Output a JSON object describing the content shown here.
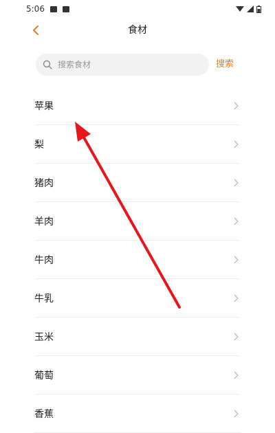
{
  "status_bar": {
    "time": "5:06"
  },
  "header": {
    "title": "食材"
  },
  "search": {
    "placeholder": "搜索食材",
    "button_label": "搜索"
  },
  "foods": [
    {
      "label": "苹果"
    },
    {
      "label": "梨"
    },
    {
      "label": "猪肉"
    },
    {
      "label": "羊肉"
    },
    {
      "label": "牛肉"
    },
    {
      "label": "牛乳"
    },
    {
      "label": "玉米"
    },
    {
      "label": "葡萄"
    },
    {
      "label": "香蕉"
    }
  ],
  "colors": {
    "accent": "#f07a22",
    "annotation": "#e8151b"
  },
  "icons": {
    "back": "chevron-left-icon",
    "search": "search-icon",
    "row": "chevron-right-icon",
    "annotation": "red-arrow-annotation"
  }
}
